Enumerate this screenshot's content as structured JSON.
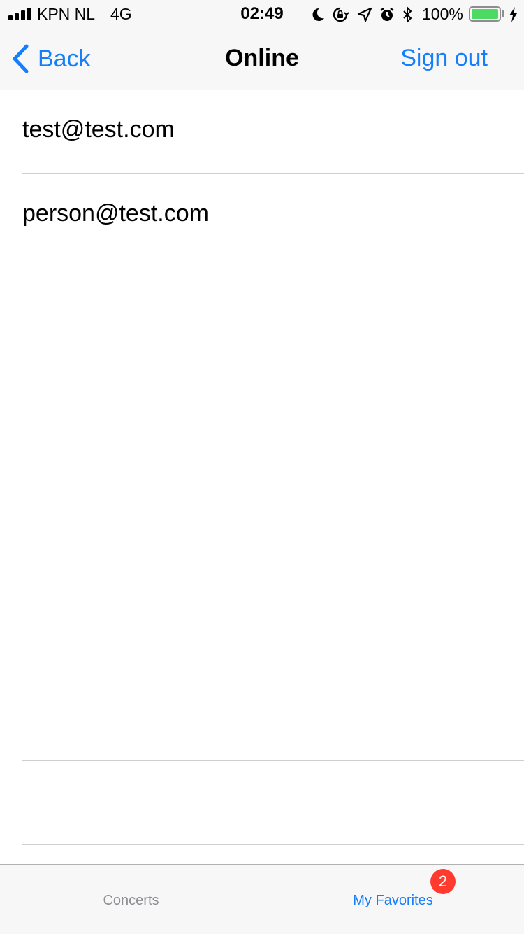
{
  "status_bar": {
    "carrier": "KPN NL",
    "network": "4G",
    "time": "02:49",
    "battery_percent": "100%",
    "battery_level": 1.0,
    "icons": [
      "signal-icon",
      "moon-icon",
      "orientation-lock-icon",
      "location-icon",
      "alarm-icon",
      "bluetooth-icon",
      "battery-icon",
      "charging-icon"
    ]
  },
  "nav": {
    "back_label": "Back",
    "title": "Online",
    "sign_out_label": "Sign out"
  },
  "list": {
    "rows": [
      "test@test.com",
      "person@test.com",
      "",
      "",
      "",
      "",
      "",
      "",
      "",
      ""
    ]
  },
  "tab_bar": {
    "tabs": [
      {
        "label": "Concerts",
        "selected": false
      },
      {
        "label": "My Favorites",
        "selected": true,
        "badge": "2"
      }
    ]
  },
  "colors": {
    "accent": "#147efb",
    "badge": "#ff3b30",
    "battery": "#4cd964",
    "inactive_tab": "#8e8e93"
  }
}
